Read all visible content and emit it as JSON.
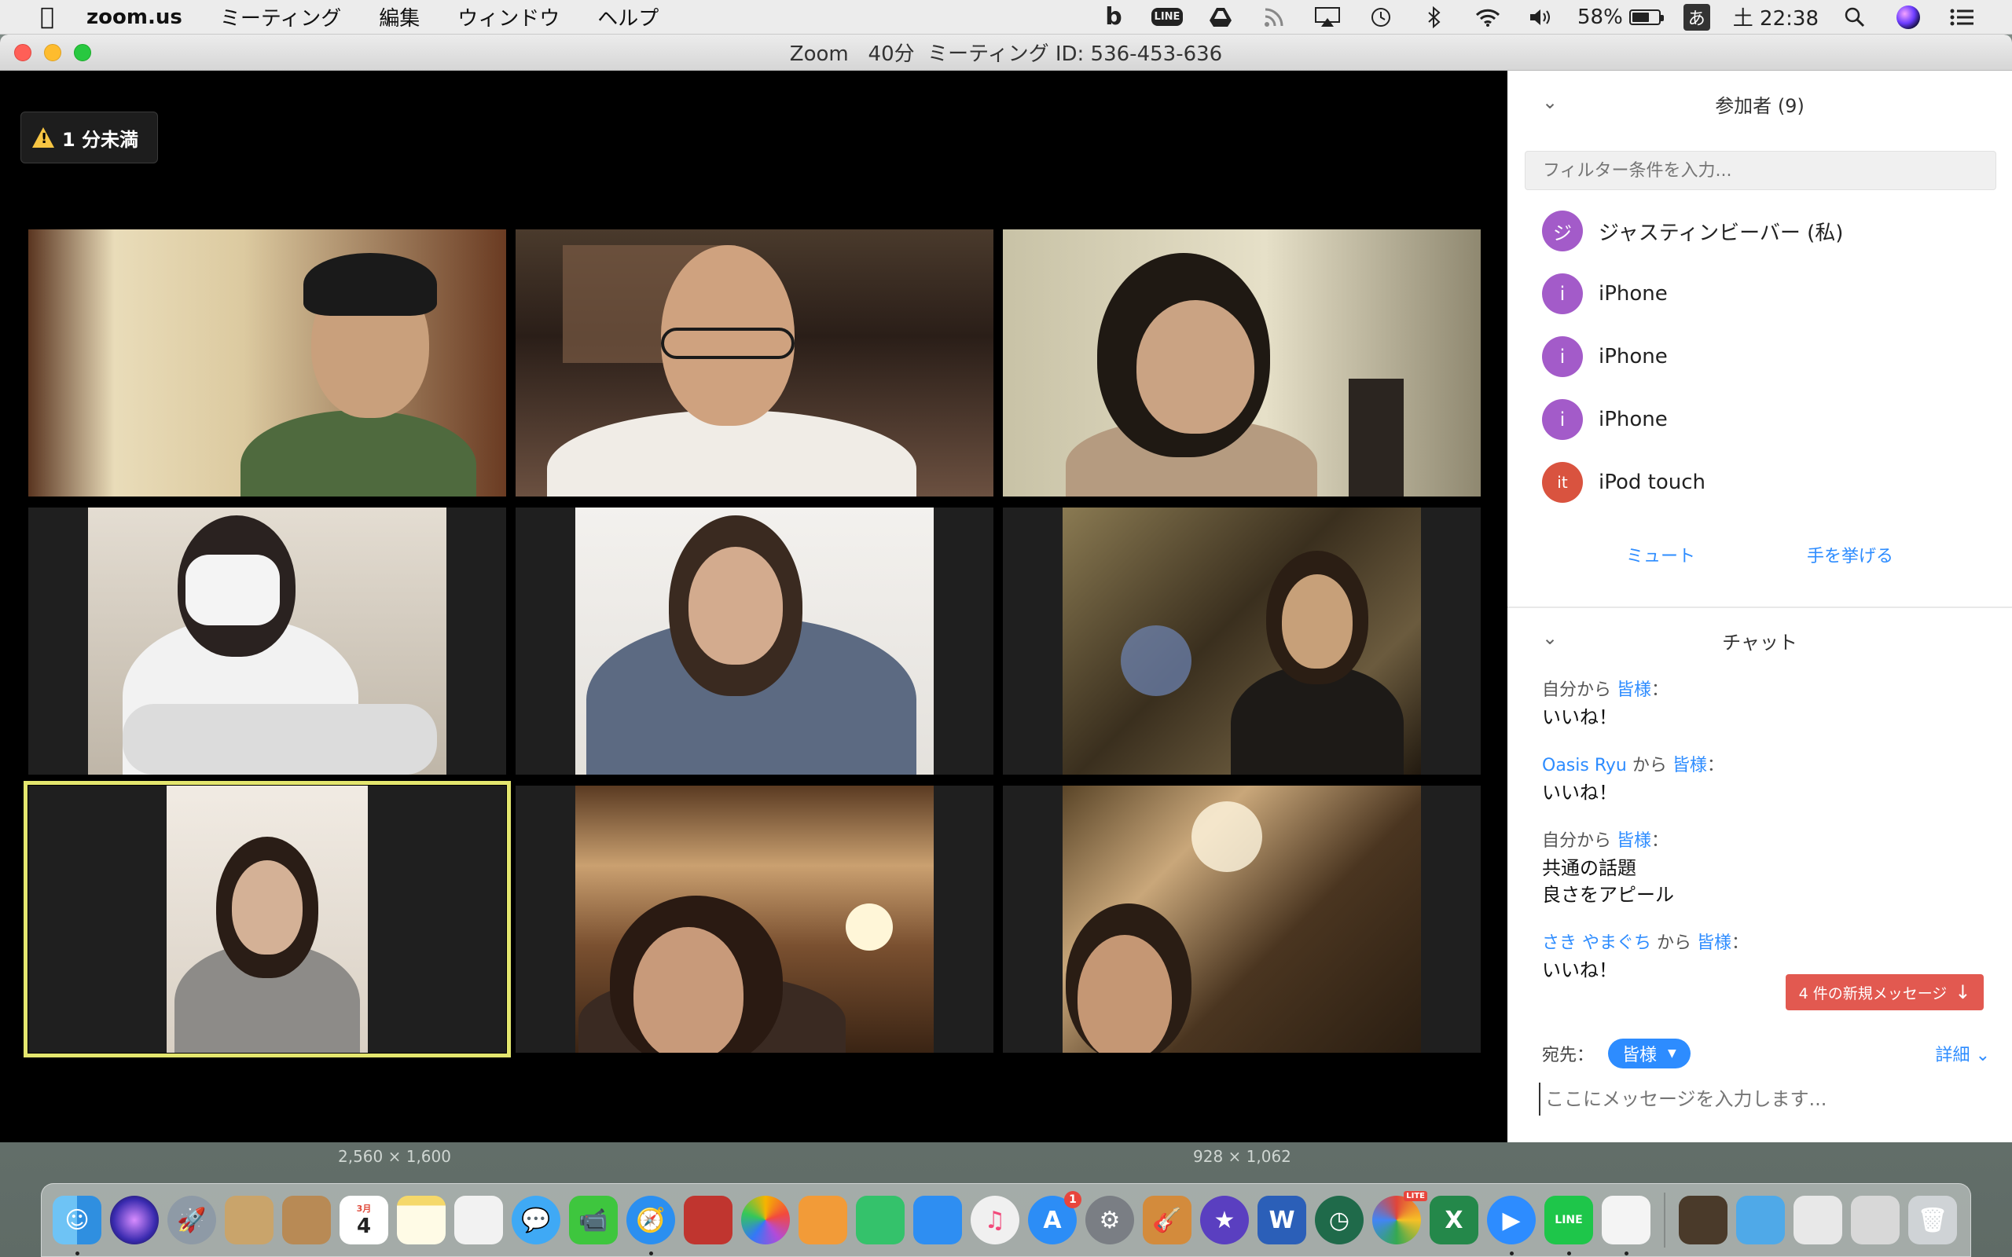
{
  "menubar": {
    "app_name": "zoom.us",
    "menus": [
      "ミーティング",
      "編集",
      "ウィンドウ",
      "ヘルプ"
    ],
    "battery_percent": "58%",
    "clock": "土 22:38",
    "status_icons": [
      "b-icon",
      "line-icon",
      "drive-icon",
      "rss-icon",
      "airplay-icon",
      "time-machine-icon",
      "bluetooth-icon",
      "wifi-icon",
      "volume-icon",
      "battery-icon",
      "ime-icon",
      "spotlight-icon",
      "siri-icon",
      "list-icon"
    ],
    "line_label": "LINE",
    "ime_label": "あ"
  },
  "window": {
    "title": "Zoom   40分  ミーティング ID: 536-453-636"
  },
  "video": {
    "time_warning": "1 分未満",
    "tiles": 9
  },
  "participants": {
    "header": "参加者 (9)",
    "filter_placeholder": "フィルター条件を入力...",
    "list": [
      {
        "initial": "ジ",
        "name": "ジャスティンビーバー (私)",
        "color": "#a35bc9"
      },
      {
        "initial": "i",
        "name": "iPhone",
        "color": "#a35bc9"
      },
      {
        "initial": "i",
        "name": "iPhone",
        "color": "#a35bc9"
      },
      {
        "initial": "i",
        "name": "iPhone",
        "color": "#a35bc9"
      },
      {
        "initial": "it",
        "name": "iPod touch",
        "color": "#d9533f"
      }
    ],
    "mute_label": "ミュート",
    "raise_hand_label": "手を挙げる"
  },
  "chat": {
    "header": "チャット",
    "messages": [
      {
        "from": "自分から",
        "to_word": "",
        "to": "皆様",
        "lines": [
          "いいね！"
        ]
      },
      {
        "from": "Oasis Ryu",
        "to_word": "から",
        "to": "皆様",
        "lines": [
          "いいね！"
        ]
      },
      {
        "from": "自分から",
        "to_word": "",
        "to": "皆様",
        "lines": [
          "共通の話題",
          "良さをアピール"
        ]
      },
      {
        "from": "さき やまぐち",
        "to_word": "から",
        "to": "皆様",
        "lines": [
          "いいね！"
        ]
      }
    ],
    "new_messages_label": "4 件の新規メッセージ",
    "recipient_label": "宛先：",
    "recipient_value": "皆様",
    "more_label": "詳細",
    "input_placeholder": "ここにメッセージを入力します..."
  },
  "desktop": {
    "label_left": "2,560 × 1,600",
    "label_right": "928 × 1,062"
  },
  "dock": {
    "calendar_month": "3月",
    "calendar_day": "4",
    "appstore_badge": "1",
    "word_label": "W",
    "excel_label": "X",
    "chrome_lite": "LITE",
    "line_label": "LINE"
  }
}
